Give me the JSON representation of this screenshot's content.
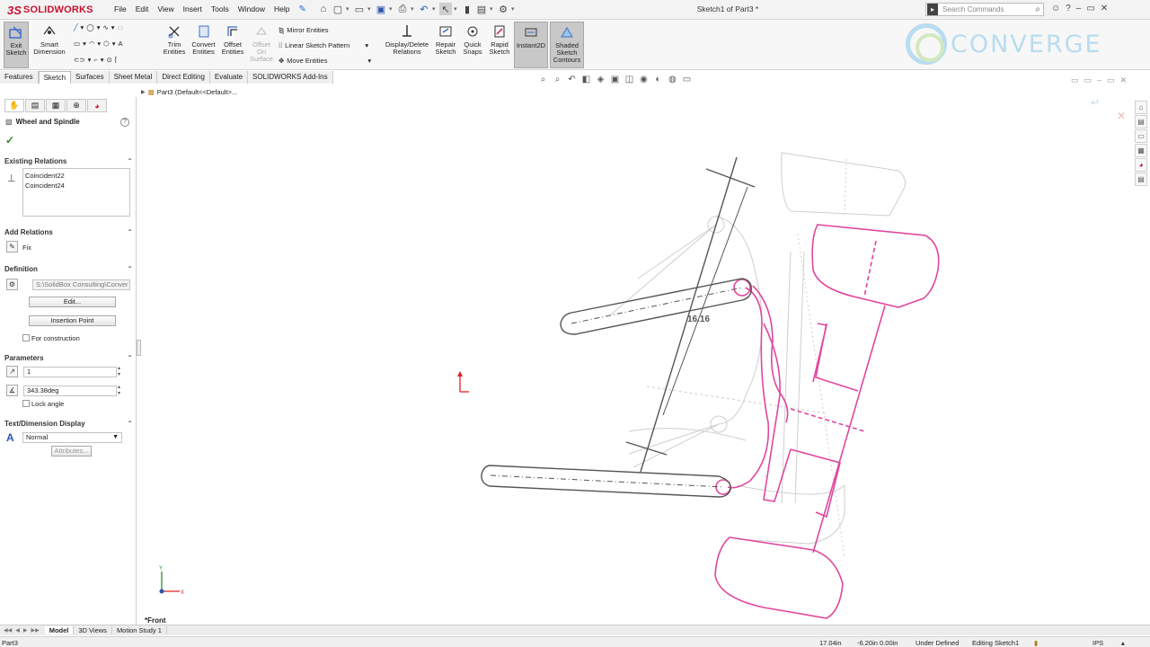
{
  "app": {
    "logo_ds": "3S",
    "logo_name": "SOLIDWORKS",
    "doc_title": "Sketch1 of Part3 *"
  },
  "menu": [
    "File",
    "Edit",
    "View",
    "Insert",
    "Tools",
    "Window",
    "Help"
  ],
  "search": {
    "placeholder": "Search Commands"
  },
  "commands": {
    "exit_sketch": "Exit Sketch",
    "smart_dimension": "Smart Dimension",
    "trim_entities": "Trim Entities",
    "convert_entities": "Convert Entities",
    "offset_entities": "Offset Entities",
    "offset_on_surface": "Offset On Surface",
    "mirror_entities": "Mirror Entities",
    "linear_sketch_pattern": "Linear Sketch Pattern",
    "move_entities": "Move Entities",
    "display_delete_relations": "Display/Delete Relations",
    "repair_sketch": "Repair Sketch",
    "quick_snaps": "Quick Snaps",
    "rapid_sketch": "Rapid Sketch",
    "instant2d": "Instant2D",
    "shaded_sketch_contours": "Shaded Sketch Contours"
  },
  "brand": {
    "text": "CONVERGE"
  },
  "tabs": [
    "Features",
    "Sketch",
    "Surfaces",
    "Sheet Metal",
    "Direct Editing",
    "Evaluate",
    "SOLIDWORKS Add-Ins"
  ],
  "tree": {
    "label": "Part3  (Default<<Default>..."
  },
  "panel": {
    "title": "Wheel and Spindle",
    "existing_relations": {
      "header": "Existing Relations",
      "items": [
        "Coincident22",
        "Coincident24"
      ]
    },
    "add_relations": {
      "header": "Add Relations",
      "fix": "Fix"
    },
    "definition": {
      "header": "Definition",
      "path": "S:\\SolidBox Consulting\\Conver",
      "edit": "Edit...",
      "insertion_point": "Insertion Point",
      "for_construction": "For construction"
    },
    "parameters": {
      "header": "Parameters",
      "scale": "1",
      "angle": "343.38deg",
      "lock_angle": "Lock angle"
    },
    "text_dimension": {
      "header": "Text/Dimension Display",
      "font": "Normal",
      "attributes": "Attributes..."
    }
  },
  "sketch": {
    "dimension": "16.16",
    "view_label": "*Front"
  },
  "bottom_tabs": [
    "Model",
    "3D Views",
    "Motion Study 1"
  ],
  "status": {
    "part": "Part3",
    "x": "17.04in",
    "y": "-6.20in 0.00in",
    "state": "Under Defined",
    "editing": "Editing Sketch1",
    "units": "IPS"
  },
  "colors": {
    "accent": "#c8102e",
    "sketch_pink": "#e0479e",
    "sketch_gray": "#555555",
    "active_btn": "#c8c8c8"
  }
}
